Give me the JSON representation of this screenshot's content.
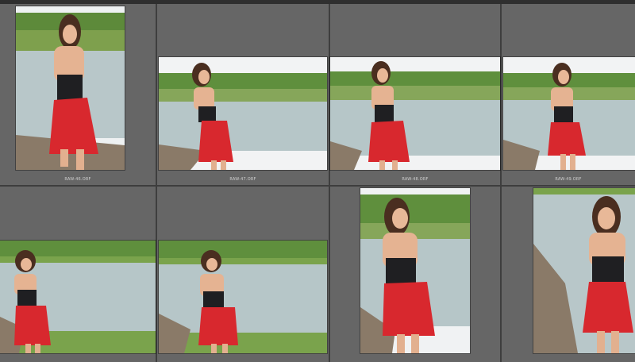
{
  "app": {
    "view": "Grid view",
    "thumbnails": [
      {
        "label": "RAW-46.ORF"
      },
      {
        "label": "RAW-47.ORF"
      },
      {
        "label": "RAW-48.ORF"
      },
      {
        "label": "RAW-49.ORF"
      },
      {
        "label": ""
      },
      {
        "label": ""
      },
      {
        "label": ""
      },
      {
        "label": ""
      }
    ]
  },
  "colors": {
    "background": "#3e3e3e",
    "cell": "#666666",
    "dress": "#d8282e",
    "top": "#1f1f22",
    "water": "#b7c4c6",
    "grass": "#6e9a3e",
    "sky": "#f2f3f4"
  }
}
